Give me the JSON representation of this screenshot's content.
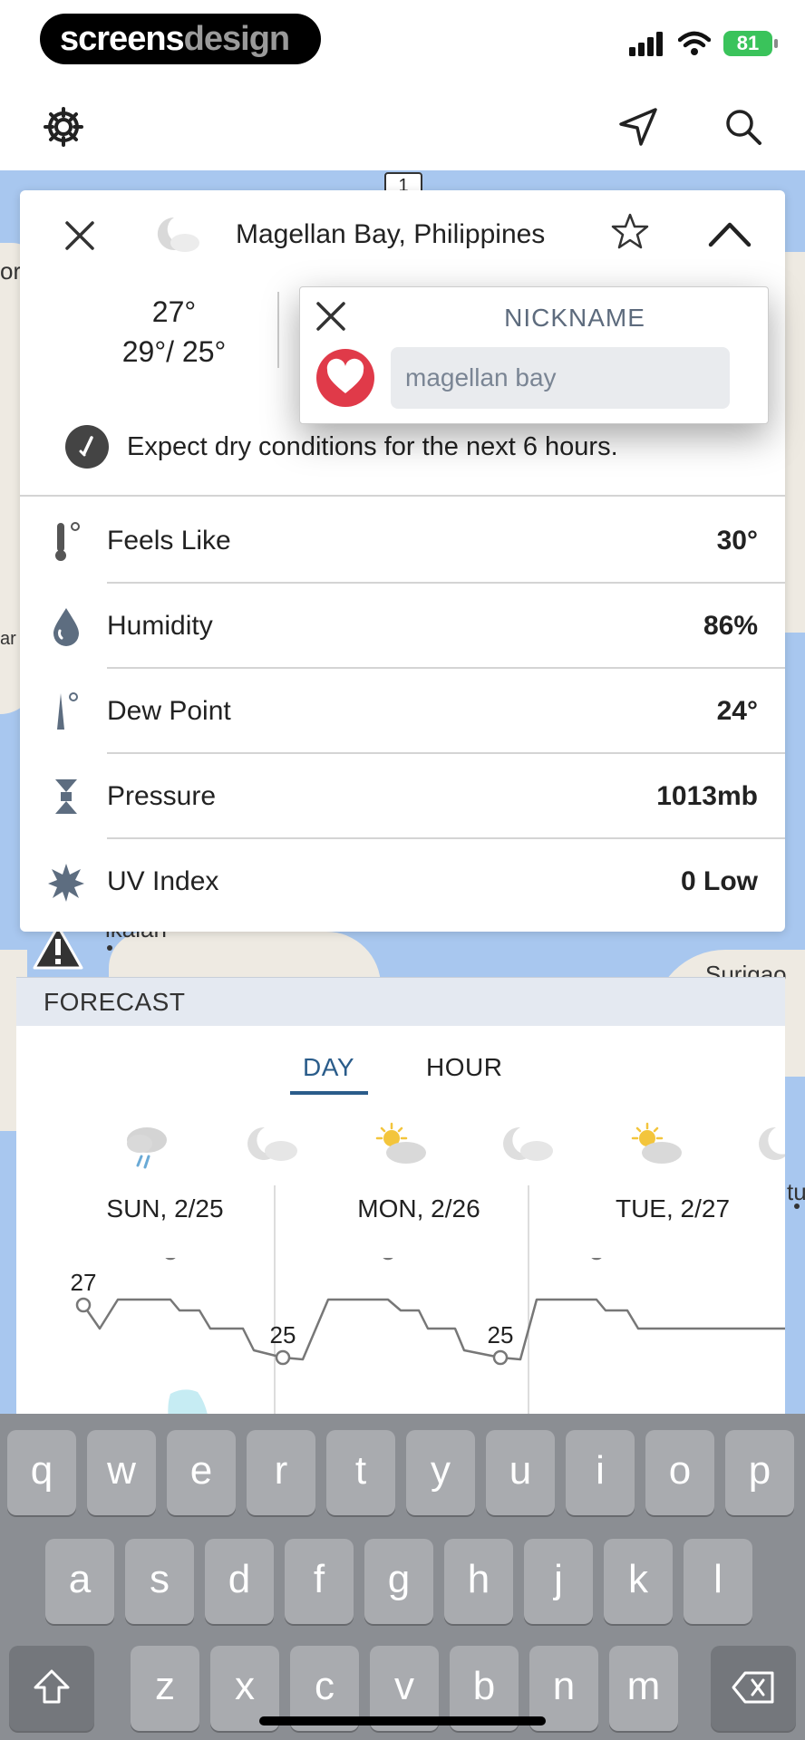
{
  "brand": {
    "part1": "screens",
    "part2": "design"
  },
  "status": {
    "battery": "81"
  },
  "location": {
    "title": "Magellan Bay, Philippines"
  },
  "current": {
    "temp": "27°",
    "hilo": "29°/ 25°"
  },
  "forecast_summary": "Expect dry conditions for the next 6 hours.",
  "observations": [
    {
      "label": "Feels Like",
      "value": "30°",
      "icon": "thermometer-icon"
    },
    {
      "label": "Humidity",
      "value": "86%",
      "icon": "droplet-icon"
    },
    {
      "label": "Dew Point",
      "value": "24°",
      "icon": "dew-point-icon"
    },
    {
      "label": "Pressure",
      "value": "1013mb",
      "icon": "pressure-icon"
    },
    {
      "label": "UV Index",
      "value": "0 Low",
      "icon": "sun-burst-icon"
    }
  ],
  "nickname": {
    "title": "NICKNAME",
    "placeholder": "magellan bay"
  },
  "map": {
    "badge": "1",
    "labels": [
      "or",
      "ar",
      "Surigao",
      "ikalan",
      "tu"
    ]
  },
  "forecast": {
    "header": "FORECAST",
    "tabs": [
      "DAY",
      "HOUR"
    ],
    "active_tab": "DAY",
    "days": [
      "SUN, 2/25",
      "MON, 2/26",
      "TUE, 2/27"
    ]
  },
  "chart_data": {
    "type": "line",
    "x": [
      "SUN, 2/25",
      "MON, 2/26",
      "TUE, 2/27"
    ],
    "series": [
      {
        "values": [
          27,
          29,
          25,
          29,
          25,
          29
        ]
      }
    ],
    "point_labels": [
      "27",
      "29",
      "25",
      "29",
      "25",
      "29"
    ]
  },
  "keyboard": {
    "row1": [
      "q",
      "w",
      "e",
      "r",
      "t",
      "y",
      "u",
      "i",
      "o",
      "p"
    ],
    "row2": [
      "a",
      "s",
      "d",
      "f",
      "g",
      "h",
      "j",
      "k",
      "l"
    ],
    "row3": [
      "z",
      "x",
      "c",
      "v",
      "b",
      "n",
      "m"
    ]
  },
  "colors": {
    "accent": "#2a5c8a",
    "heart": "#e03a49",
    "battery": "#3ac35b",
    "map_water": "#a8c7ef"
  }
}
